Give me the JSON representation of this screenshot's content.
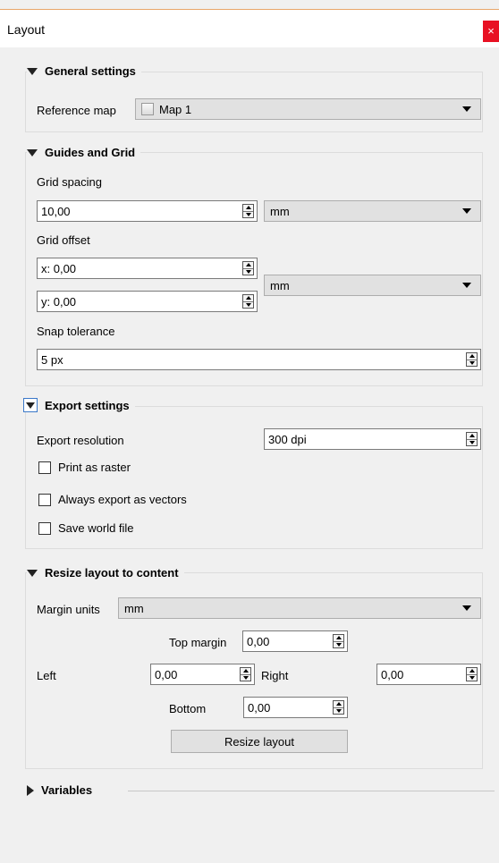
{
  "window": {
    "title": "Layout",
    "close": "×"
  },
  "general": {
    "title": "General settings",
    "reference_map_label": "Reference map",
    "reference_map_value": "Map 1"
  },
  "guides": {
    "title": "Guides and Grid",
    "grid_spacing_label": "Grid spacing",
    "grid_spacing_value": "10,00",
    "grid_spacing_unit": "mm",
    "grid_offset_label": "Grid offset",
    "offset_x": "x: 0,00",
    "offset_y": "y: 0,00",
    "offset_unit": "mm",
    "snap_label": "Snap tolerance",
    "snap_value": "5 px"
  },
  "export": {
    "title": "Export settings",
    "resolution_label": "Export resolution",
    "resolution_value": "300 dpi",
    "print_raster": "Print as raster",
    "always_vectors": "Always export as vectors",
    "save_world": "Save world file"
  },
  "resize": {
    "title": "Resize layout to content",
    "margin_units_label": "Margin units",
    "margin_units_value": "mm",
    "top_label": "Top margin",
    "top_value": "0,00",
    "left_label": "Left",
    "left_value": "0,00",
    "right_label": "Right",
    "right_value": "0,00",
    "bottom_label": "Bottom",
    "bottom_value": "0,00",
    "button": "Resize layout"
  },
  "variables": {
    "title": "Variables"
  }
}
